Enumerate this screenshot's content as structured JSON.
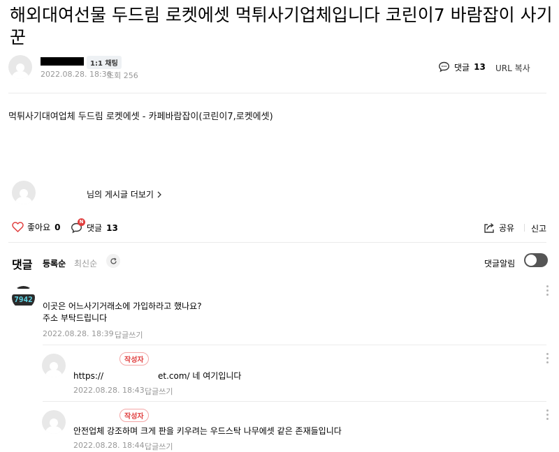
{
  "post": {
    "title": "해외대여선물 두드림 로켓에셋 먹튀사기업체입니다 코린이7 바람잡이 사기꾼",
    "chat_badge": "1:1 채팅",
    "date": "2022.08.28. 18:36",
    "views_label": "조회 256",
    "comment_label": "댓글",
    "comment_count": "13",
    "url_copy": "URL 복사",
    "body": "먹튀사기대여업체 두드림 로켓에셋 - 카페바람잡이(코린이7,로켓에셋)",
    "more_posts": "님의 게시글 더보기"
  },
  "actions": {
    "like_label": "좋아요",
    "like_count": "0",
    "new_badge": "N",
    "comment_label": "댓글",
    "comment_count": "13",
    "share_label": "공유",
    "report_label": "신고"
  },
  "comments_header": {
    "title": "댓글",
    "sort_registered": "등록순",
    "sort_latest": "최신순",
    "notify_label": "댓글알림"
  },
  "comments": [
    {
      "avatar_text": "7942",
      "text_line1": "이곳은 어느사기거래소에 가입하라고 했나요?",
      "text_line2": "주소 부탁드립니다",
      "date": "2022.08.28. 18:39",
      "reply_label": "답글쓰기"
    },
    {
      "author_badge": "작성자",
      "text_prefix": "https://",
      "text_suffix": "et.com/ 네 여기입니다",
      "date": "2022.08.28. 18:43",
      "reply_label": "답글쓰기"
    },
    {
      "author_badge": "작성자",
      "text": "안전업체 강조하며 크게 판을 키우려는 우드스탁 나무에셋 같은 존재들입니다",
      "date": "2022.08.28. 18:44",
      "reply_label": "답글쓰기"
    }
  ],
  "colors": {
    "heart": "#e03e3e",
    "new_badge": "#e03e3e",
    "author_badge": "#e03e3e",
    "toggle_off": "#555555"
  }
}
